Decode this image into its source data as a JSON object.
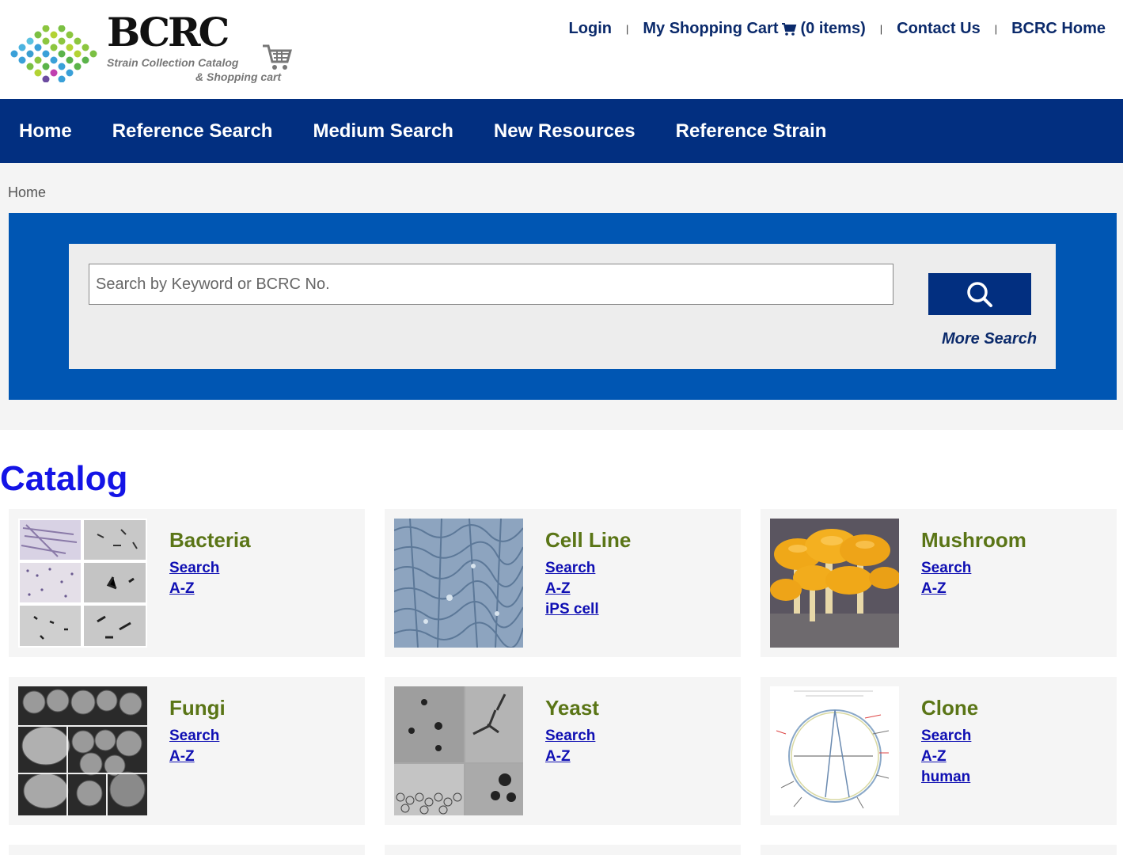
{
  "header": {
    "logo_word": "BCRC",
    "logo_subtitle_1": "Strain Collection Catalog",
    "logo_subtitle_2": "& Shopping cart",
    "links": {
      "login": "Login",
      "cart": "My Shopping Cart",
      "cart_count": "(0 items)",
      "contact": "Contact Us",
      "home": "BCRC Home"
    }
  },
  "nav": {
    "items": [
      "Home",
      "Reference Search",
      "Medium Search",
      "New Resources",
      "Reference Strain"
    ]
  },
  "breadcrumb": "Home",
  "search": {
    "placeholder": "Search by Keyword or BCRC No.",
    "more_search": "More Search"
  },
  "catalog": {
    "title": "Catalog",
    "cards": [
      {
        "name": "Bacteria",
        "links": [
          "Search",
          "A-Z"
        ]
      },
      {
        "name": "Cell Line",
        "links": [
          "Search",
          "A-Z",
          "iPS cell"
        ]
      },
      {
        "name": "Mushroom",
        "links": [
          "Search",
          "A-Z"
        ]
      },
      {
        "name": "Fungi",
        "links": [
          "Search",
          "A-Z"
        ]
      },
      {
        "name": "Yeast",
        "links": [
          "Search",
          "A-Z"
        ]
      },
      {
        "name": "Clone",
        "links": [
          "Search",
          "A-Z",
          "human"
        ]
      }
    ]
  },
  "colors": {
    "nav_bg": "#022f80",
    "panel_blue": "#0056b3",
    "category_green": "#5a7516",
    "link_blue": "#0f0fb3",
    "catalog_title": "#1414e6"
  }
}
